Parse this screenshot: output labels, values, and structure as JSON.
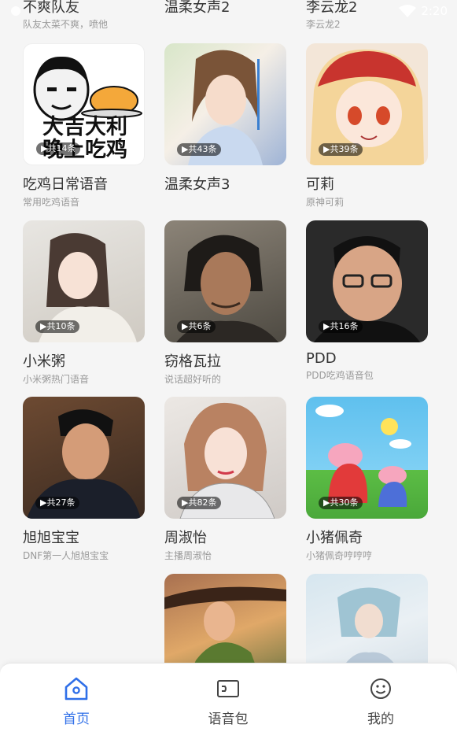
{
  "status_bar": {
    "time": "2:20"
  },
  "top_row": [
    {
      "title": "不爽队友",
      "subtitle": "队友太菜不爽，喷他"
    },
    {
      "title": "温柔女声2",
      "subtitle": ""
    },
    {
      "title": "李云龙2",
      "subtitle": "李云龙2"
    }
  ],
  "cards": [
    {
      "title": "吃鸡日常语音",
      "subtitle": "常用吃鸡语音",
      "count": "共14条",
      "thumb_text_line1": "大吉大利",
      "thumb_text_line2": "晚上吃鸡"
    },
    {
      "title": "温柔女声3",
      "subtitle": "",
      "count": "共43条"
    },
    {
      "title": "可莉",
      "subtitle": "原神可莉",
      "count": "共39条"
    },
    {
      "title": "小米粥",
      "subtitle": "小米粥热门语音",
      "count": "共10条"
    },
    {
      "title": "窃格瓦拉",
      "subtitle": "说话超好听的",
      "count": "共6条"
    },
    {
      "title": "PDD",
      "subtitle": "PDD吃鸡语音包",
      "count": "共16条"
    },
    {
      "title": "旭旭宝宝",
      "subtitle": "DNF第一人旭旭宝宝",
      "count": "共27条"
    },
    {
      "title": "周淑怡",
      "subtitle": "主播周淑怡",
      "count": "共82条"
    },
    {
      "title": "小猪佩奇",
      "subtitle": "小猪佩奇哼哼哼",
      "count": "共30条"
    }
  ],
  "tabs": [
    {
      "label": "首页",
      "icon": "home-icon"
    },
    {
      "label": "语音包",
      "icon": "voice-pack-icon"
    },
    {
      "label": "我的",
      "icon": "profile-smile-icon"
    }
  ],
  "colors": {
    "accent": "#2f6fe8"
  }
}
